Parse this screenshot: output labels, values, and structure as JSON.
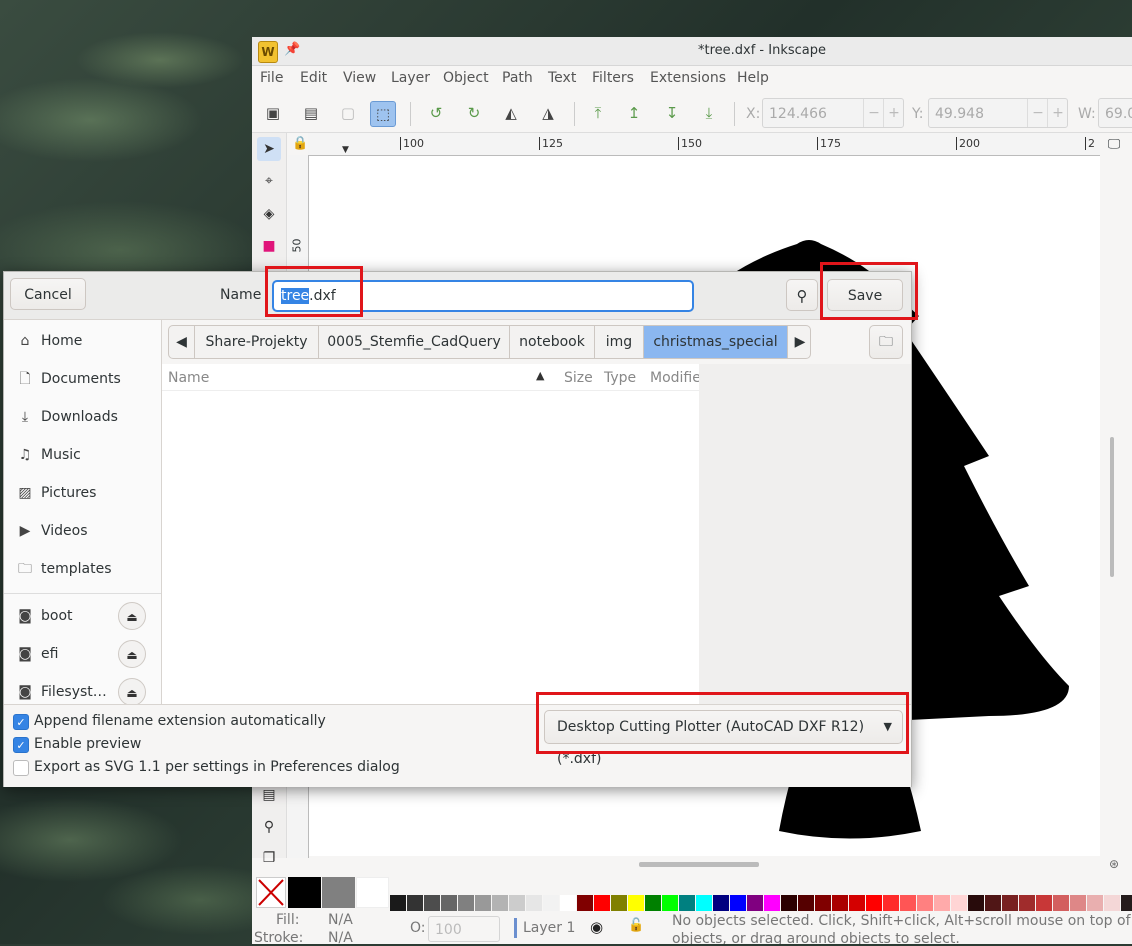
{
  "window": {
    "title": "*tree.dxf - Inkscape",
    "app_icon_letter": "W"
  },
  "menubar": [
    "File",
    "Edit",
    "View",
    "Layer",
    "Object",
    "Path",
    "Text",
    "Filters",
    "Extensions",
    "Help"
  ],
  "toolbar": {
    "x_label": "X:",
    "x_value": "124.466",
    "y_label": "Y:",
    "y_value": "49.948",
    "w_label": "W:",
    "w_value": "69.0",
    "minus": "−",
    "plus": "+"
  },
  "rulers": {
    "top_ticks": [
      "100",
      "125",
      "150",
      "175",
      "200",
      "2"
    ],
    "left_ticks": [
      "50"
    ]
  },
  "statusbar": {
    "fill_label": "Fill:",
    "fill_value": "N/A",
    "stroke_label": "Stroke:",
    "stroke_value": "N/A",
    "opacity_label": "O:",
    "opacity_value": "100",
    "layer": "Layer 1",
    "message": "No objects selected. Click, Shift+click, Alt+scroll mouse on top of objects, or drag around objects to select."
  },
  "palette": {
    "colors": [
      "#1a1a1a",
      "#333333",
      "#4d4d4d",
      "#666666",
      "#808080",
      "#999999",
      "#b3b3b3",
      "#cccccc",
      "#e6e6e6",
      "#f2f2f2",
      "#ffffff",
      "#800000",
      "#ff0000",
      "#808000",
      "#ffff00",
      "#008000",
      "#00ff00",
      "#008080",
      "#00ffff",
      "#000080",
      "#0000ff",
      "#800080",
      "#ff00ff",
      "#2b0000",
      "#550000",
      "#800000",
      "#aa0000",
      "#d40000",
      "#ff0000",
      "#ff2a2a",
      "#ff5555",
      "#ff8080",
      "#ffaaaa",
      "#ffd5d5",
      "#280b0b",
      "#501616",
      "#782121",
      "#a02c2c",
      "#c83737",
      "#d35f5f",
      "#de8787",
      "#e9afaf",
      "#f4d7d7",
      "#241c1c"
    ]
  },
  "dialog": {
    "cancel_label": "Cancel",
    "name_label": "Name",
    "filename_selected": "tree",
    "filename_rest": ".dxf",
    "save_label": "Save",
    "places": [
      {
        "icon": "home-icon",
        "label": "Home"
      },
      {
        "icon": "document-icon",
        "label": "Documents"
      },
      {
        "icon": "download-icon",
        "label": "Downloads"
      },
      {
        "icon": "music-icon",
        "label": "Music"
      },
      {
        "icon": "pictures-icon",
        "label": "Pictures"
      },
      {
        "icon": "videos-icon",
        "label": "Videos"
      },
      {
        "icon": "folder-icon",
        "label": "templates"
      }
    ],
    "devices": [
      {
        "label": "boot"
      },
      {
        "label": "efi"
      },
      {
        "label": "Filesyst…"
      }
    ],
    "breadcrumbs": [
      "Share-Projekty",
      "0005_Stemfie_CadQuery",
      "notebook",
      "img",
      "christmas_special"
    ],
    "columns": {
      "name": "Name",
      "size": "Size",
      "type": "Type",
      "modified": "Modifie"
    },
    "options": [
      {
        "label": "Append filename extension automatically",
        "checked": true
      },
      {
        "label": "Enable preview",
        "checked": true
      },
      {
        "label": "Export as SVG 1.1 per settings in Preferences dialog",
        "checked": false
      }
    ],
    "filter": "Desktop Cutting Plotter (AutoCAD DXF R12) (*.dxf)"
  },
  "highlight_color": "#e0151a",
  "accent_color": "#3584e4"
}
